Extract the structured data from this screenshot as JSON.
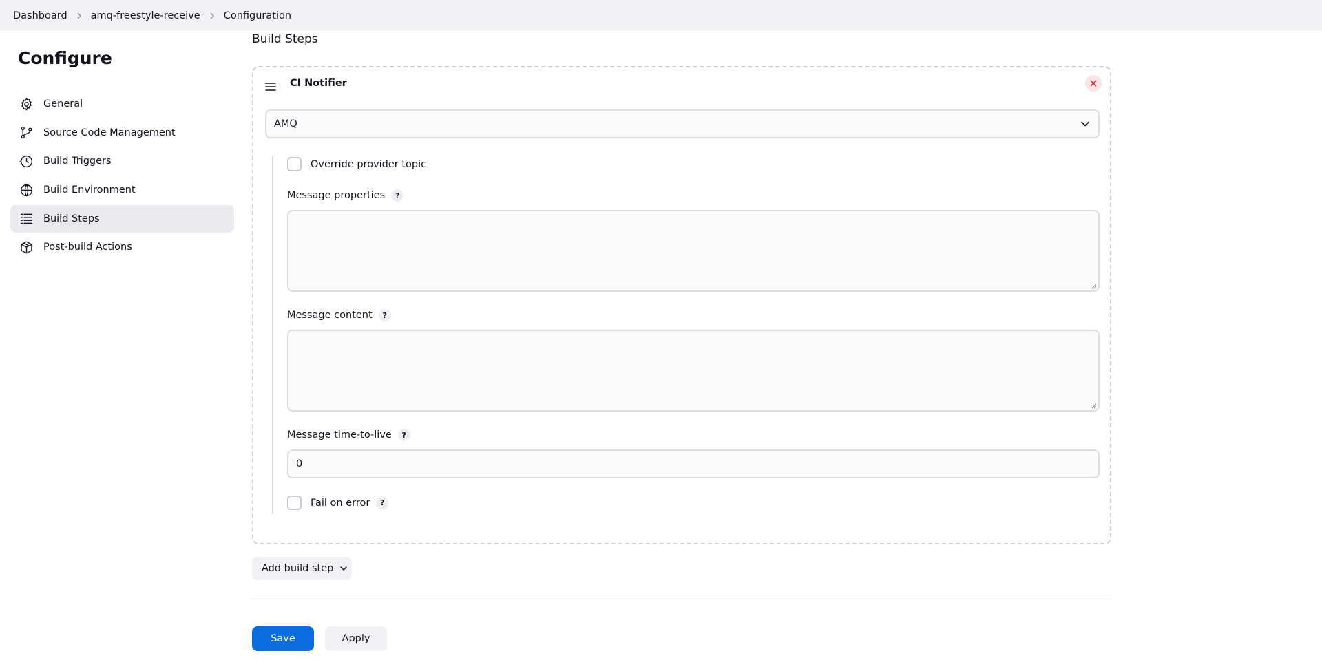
{
  "breadcrumb": {
    "items": [
      "Dashboard",
      "amq-freestyle-receive",
      "Configuration"
    ]
  },
  "sidebar": {
    "title": "Configure",
    "items": [
      {
        "label": "General",
        "icon": "gear-icon"
      },
      {
        "label": "Source Code Management",
        "icon": "branch-icon"
      },
      {
        "label": "Build Triggers",
        "icon": "clock-icon"
      },
      {
        "label": "Build Environment",
        "icon": "globe-icon"
      },
      {
        "label": "Build Steps",
        "icon": "list-icon",
        "active": true
      },
      {
        "label": "Post-build Actions",
        "icon": "package-icon"
      }
    ]
  },
  "main": {
    "section_title": "Build Steps",
    "step": {
      "title": "CI Notifier",
      "provider_select": {
        "value": "AMQ"
      },
      "override_topic": {
        "label": "Override provider topic",
        "checked": false
      },
      "message_properties": {
        "label": "Message properties",
        "help": "?",
        "value": ""
      },
      "message_content": {
        "label": "Message content",
        "help": "?",
        "value": ""
      },
      "message_ttl": {
        "label": "Message time-to-live",
        "help": "?",
        "value": "0"
      },
      "fail_on_error": {
        "label": "Fail on error",
        "help": "?",
        "checked": false
      }
    },
    "add_build_step_label": "Add build step"
  },
  "actions": {
    "save_label": "Save",
    "apply_label": "Apply"
  },
  "colors": {
    "primary": "#0b6de0",
    "active_nav_bg": "#e9e9ee",
    "close_button_bg": "#fde4e6",
    "close_icon": "#d2293a"
  }
}
